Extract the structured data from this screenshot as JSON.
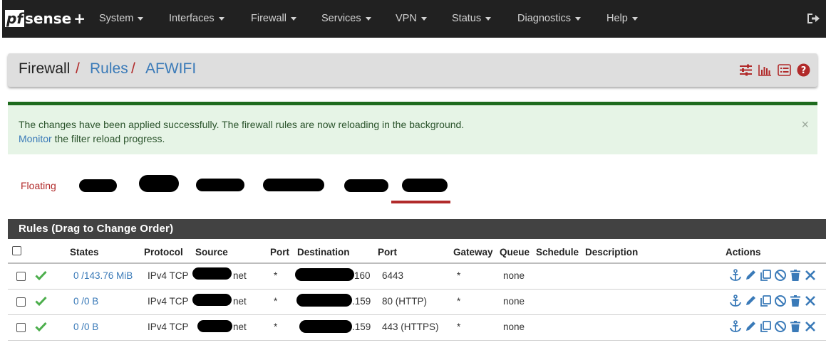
{
  "brand": {
    "pf": "pf",
    "sense": "sense",
    "plus": "+"
  },
  "nav": {
    "items": [
      {
        "label": "System"
      },
      {
        "label": "Interfaces"
      },
      {
        "label": "Firewall"
      },
      {
        "label": "Services"
      },
      {
        "label": "VPN"
      },
      {
        "label": "Status"
      },
      {
        "label": "Diagnostics"
      },
      {
        "label": "Help"
      }
    ],
    "logout_icon": "sign-out-icon"
  },
  "breadcrumb": {
    "parts": [
      "Firewall",
      "Rules",
      "AFWIFI"
    ],
    "separator": "/",
    "icons": [
      "sliders-icon",
      "bar-chart-icon",
      "list-icon",
      "help-icon"
    ]
  },
  "alert": {
    "line1": "The changes have been applied successfully. The firewall rules are now reloading in the background.",
    "link": "Monitor",
    "line2_rest": " the filter reload progress.",
    "close": "×"
  },
  "tabs": {
    "first": "Floating"
  },
  "rules": {
    "title": "Rules (Drag to Change Order)",
    "columns": [
      "States",
      "Protocol",
      "Source",
      "Port",
      "Destination",
      "Port",
      "Gateway",
      "Queue",
      "Schedule",
      "Description",
      "Actions"
    ],
    "rows": [
      {
        "states": "0 /143.76 MiB",
        "protocol": "IPv4 TCP",
        "source_suffix": "net",
        "src_port": "*",
        "dest_suffix": "160",
        "dst_port": "6443",
        "gateway": "*",
        "queue": "none"
      },
      {
        "states": "0 /0 B",
        "protocol": "IPv4 TCP",
        "source_suffix": "net",
        "src_port": "*",
        "dest_suffix": ".159",
        "dst_port": "80 (HTTP)",
        "gateway": "*",
        "queue": "none"
      },
      {
        "states": "0 /0 B",
        "protocol": "IPv4 TCP",
        "source_suffix": "net",
        "src_port": "*",
        "dest_suffix": ".159",
        "dst_port": "443 (HTTPS)",
        "gateway": "*",
        "queue": "none"
      }
    ],
    "action_icons": [
      "anchor-icon",
      "pencil-icon",
      "copy-icon",
      "ban-icon",
      "trash-icon",
      "times-icon"
    ]
  },
  "colors": {
    "accent_red": "#b12a2a",
    "link_blue": "#3a7ab8",
    "success_green": "#1e6b1e",
    "navbar": "#212121"
  }
}
